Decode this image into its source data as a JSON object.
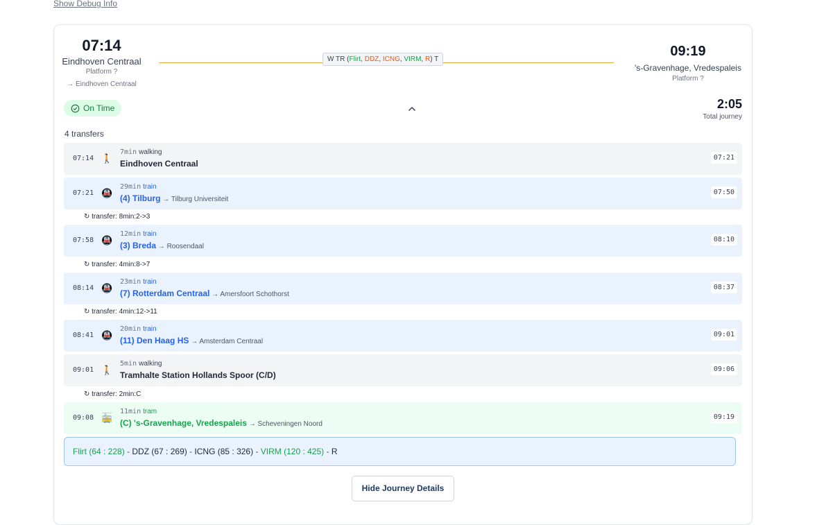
{
  "debug_link": "Show Debug Info",
  "journey": {
    "departure": {
      "time": "07:14",
      "station": "Eindhoven Centraal",
      "platform": "Platform ?",
      "direction": "→ Eindhoven Centraal"
    },
    "arrival": {
      "time": "09:19",
      "station": "'s-Gravenhage, Vredespaleis",
      "platform": "Platform ?"
    },
    "route_summary": {
      "prefix": "W TR (",
      "flirt": "Flirt",
      "ddz": "DDZ",
      "icng": "ICNG",
      "virm": "VIRM",
      "r": "R",
      "suffix": ") T",
      "sep": ", "
    },
    "status": "On Time",
    "total_time": "2:05",
    "total_label": "Total journey",
    "transfers_label": "4 transfers"
  },
  "segments": [
    {
      "start": "07:14",
      "duration": "7min",
      "mode": "walking",
      "line": "Eindhoven Centraal",
      "direction": "",
      "end": "07:21",
      "icon": "walking-icon"
    },
    {
      "start": "07:21",
      "duration": "29min",
      "mode": "train",
      "line": "(4) Tilburg",
      "direction": " → Tilburg Universiteit",
      "end": "07:50",
      "icon": "train-icon"
    },
    {
      "start": "07:58",
      "duration": "12min",
      "mode": "train",
      "line": "(3) Breda",
      "direction": " → Roosendaal",
      "end": "08:10",
      "icon": "train-icon"
    },
    {
      "start": "08:14",
      "duration": "23min",
      "mode": "train",
      "line": "(7) Rotterdam Centraal",
      "direction": " → Amersfoort Schothorst",
      "end": "08:37",
      "icon": "train-icon"
    },
    {
      "start": "08:41",
      "duration": "20min",
      "mode": "train",
      "line": "(11) Den Haag HS",
      "direction": " → Amsterdam Centraal",
      "end": "09:01",
      "icon": "train-icon"
    },
    {
      "start": "09:01",
      "duration": "5min",
      "mode": "walking",
      "line": "Tramhalte Station Hollands Spoor (C/D)",
      "direction": "",
      "end": "09:06",
      "icon": "walking-icon"
    },
    {
      "start": "09:08",
      "duration": "11min",
      "mode": "tram",
      "line": "(C) 's-Gravenhage, Vredespaleis",
      "direction": " → Scheveningen Noord",
      "end": "09:19",
      "icon": "tram-icon"
    }
  ],
  "transfers": [
    "↻ transfer: 8min:2->3",
    "↻ transfer: 4min:8->7",
    "↻ transfer: 4min:12->11",
    "↻ transfer: 2min:C"
  ],
  "capacity": {
    "flirt": "Flirt (64 : 228)",
    "ddz": "DDZ (67 : 269)",
    "icng": "ICNG (85 : 326)",
    "virm": "VIRM (120 : 425)",
    "r": "R",
    "sep": " - "
  },
  "hide_button": "Hide Journey Details",
  "colors": {
    "train": "#2563eb",
    "tram": "#16a34a",
    "ontime_bg": "#dcfce7",
    "route_line": "#e0a93b"
  }
}
